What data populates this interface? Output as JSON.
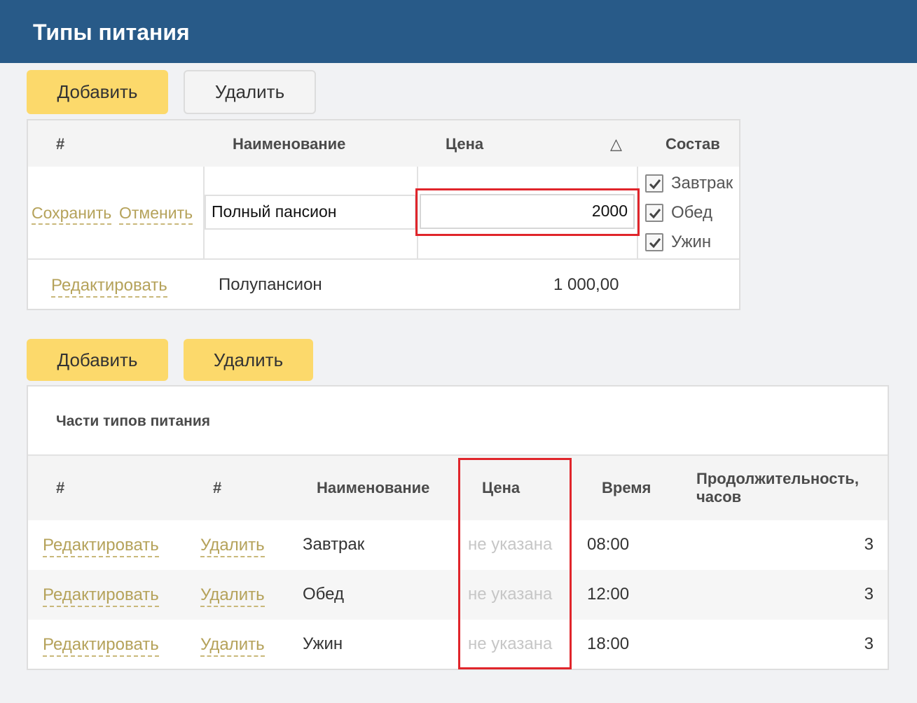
{
  "page": {
    "title": "Типы питания"
  },
  "toolbar1": {
    "add_label": "Добавить",
    "delete_label": "Удалить"
  },
  "meal_types": {
    "columns": {
      "num": "#",
      "name": "Наименование",
      "price": "Цена",
      "sort_icon": "triangle-up-icon",
      "sort_glyph": "△",
      "composition": "Состав"
    },
    "edit_row": {
      "save_label": "Сохранить",
      "cancel_label": "Отменить",
      "name_value": "Полный пансион",
      "price_value": "2000",
      "components": [
        {
          "label": "Завтрак",
          "checked": true
        },
        {
          "label": "Обед",
          "checked": true
        },
        {
          "label": "Ужин",
          "checked": true
        }
      ]
    },
    "rows": [
      {
        "edit_label": "Редактировать",
        "name": "Полупансион",
        "price": "1 000,00"
      }
    ]
  },
  "toolbar2": {
    "add_label": "Добавить",
    "delete_label": "Удалить"
  },
  "meal_parts": {
    "title": "Части типов питания",
    "columns": {
      "num1": "#",
      "num2": "#",
      "name": "Наименование",
      "price": "Цена",
      "time": "Время",
      "duration_line1": "Продолжительность,",
      "duration_line2": "часов"
    },
    "rows": [
      {
        "edit_label": "Редактировать",
        "delete_label": "Удалить",
        "name": "Завтрак",
        "price": "не указана",
        "time": "08:00",
        "duration": "3"
      },
      {
        "edit_label": "Редактировать",
        "delete_label": "Удалить",
        "name": "Обед",
        "price": "не указана",
        "time": "12:00",
        "duration": "3"
      },
      {
        "edit_label": "Редактировать",
        "delete_label": "Удалить",
        "name": "Ужин",
        "price": "не указана",
        "time": "18:00",
        "duration": "3"
      }
    ]
  },
  "colors": {
    "header": "#285a88",
    "button_yellow": "#fcd96b",
    "link": "#b5a25a",
    "highlight": "#e0252b"
  }
}
